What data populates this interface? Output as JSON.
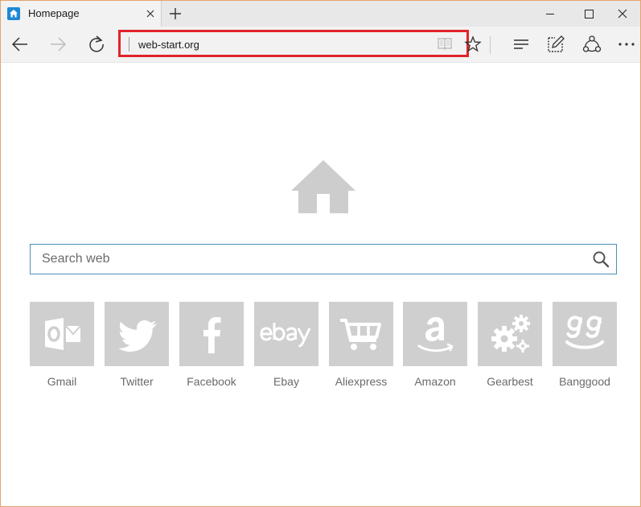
{
  "tab": {
    "title": "Homepage",
    "icon": "home-icon"
  },
  "window_controls": {
    "minimize": "minimize-icon",
    "maximize": "maximize-icon",
    "close": "close-icon"
  },
  "toolbar": {
    "back": "back-arrow-icon",
    "forward": "forward-arrow-icon",
    "refresh": "refresh-icon",
    "address": "web-start.org",
    "reading_view": "reading-view-icon",
    "favorite": "star-icon",
    "hub": "hub-icon",
    "web_note": "web-note-icon",
    "share": "share-icon",
    "more": "more-icon"
  },
  "colors": {
    "highlight_border": "#e2232a",
    "tile_bg": "#cfcfcf",
    "search_border": "#4a90b8"
  },
  "search": {
    "placeholder": "Search web",
    "icon": "search-icon"
  },
  "hero_icon": "home-icon",
  "tiles": [
    {
      "label": "Gmail",
      "icon": "outlook-icon"
    },
    {
      "label": "Twitter",
      "icon": "twitter-icon"
    },
    {
      "label": "Facebook",
      "icon": "facebook-icon"
    },
    {
      "label": "Ebay",
      "icon": "ebay-icon"
    },
    {
      "label": "Aliexpress",
      "icon": "shopping-cart-icon"
    },
    {
      "label": "Amazon",
      "icon": "amazon-icon"
    },
    {
      "label": "Gearbest",
      "icon": "gears-icon"
    },
    {
      "label": "Banggood",
      "icon": "banggood-icon"
    }
  ]
}
